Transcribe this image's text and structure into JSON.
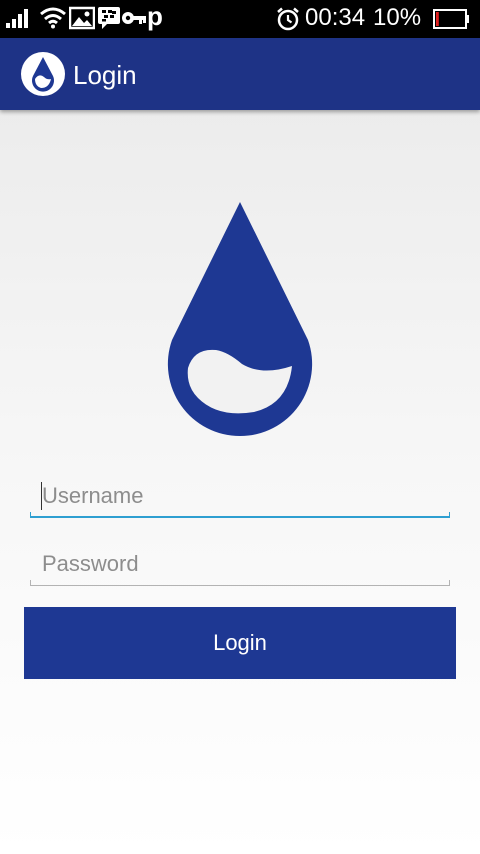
{
  "status_bar": {
    "time": "00:34",
    "battery_percent_label": "10%",
    "battery_level": 0.1,
    "icons": [
      "signal-icon",
      "wifi-icon",
      "image-icon",
      "bbm-icon",
      "key-icon",
      "p-icon",
      "alarm-icon",
      "battery-icon"
    ],
    "p_glyph": "p"
  },
  "app_bar": {
    "title": "Login",
    "color": "#1e3386"
  },
  "form": {
    "username_placeholder": "Username",
    "password_placeholder": "Password",
    "login_label": "Login"
  },
  "colors": {
    "brand": "#1e3893",
    "focus_underline": "#2e9fd1"
  }
}
